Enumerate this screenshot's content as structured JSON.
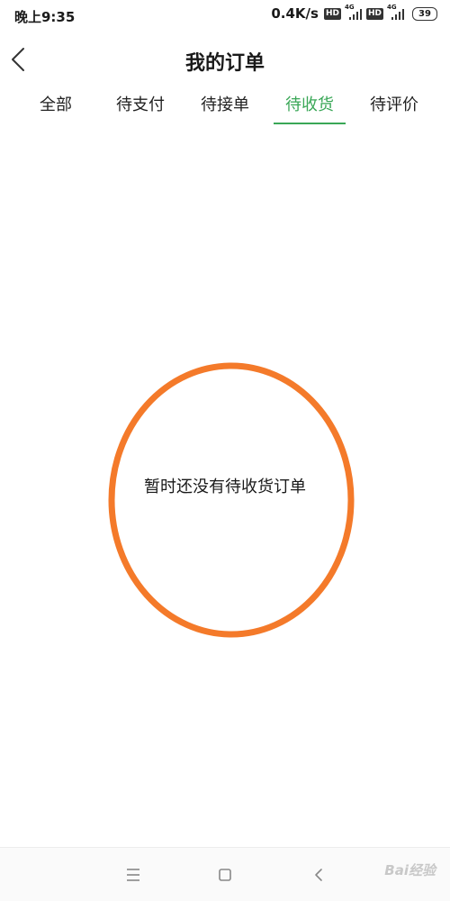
{
  "status_bar": {
    "time": "晚上9:35",
    "net_speed": "0.4K/s",
    "hd_label": "HD",
    "network_type": "4G",
    "battery": "39"
  },
  "header": {
    "title": "我的订单",
    "back_icon": "chevron-left-icon"
  },
  "tabs": [
    {
      "label": "全部",
      "active": false
    },
    {
      "label": "待支付",
      "active": false
    },
    {
      "label": "待接单",
      "active": false
    },
    {
      "label": "待收货",
      "active": true
    },
    {
      "label": "待评价",
      "active": false
    }
  ],
  "empty_state": {
    "message": "暂时还没有待收货订单"
  },
  "colors": {
    "accent": "#3aa757",
    "annotation_ring": "#f47a2a"
  },
  "bottom_nav": {
    "icons": [
      "menu-icon",
      "home-icon",
      "back-icon"
    ],
    "watermark": "Bai经验"
  }
}
